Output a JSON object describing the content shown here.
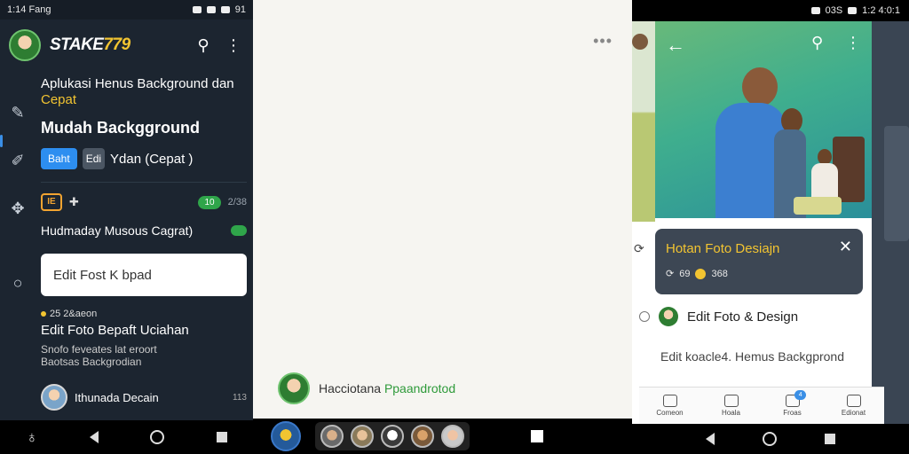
{
  "left": {
    "status_time": "1:14 Fang",
    "status_right": "91",
    "brand_text": "STAKE",
    "brand_num": "779",
    "heading_line": "Aplukasi Henus Background dan",
    "heading_highlight": "Cepat",
    "subtitle": "Mudah Backgground",
    "chip_blue": "Baht",
    "chip_gray": "Edi",
    "chip_text": "Ydan (Cepat )",
    "row_icon_label": "IE",
    "pill": "10",
    "pill_num": "2/38",
    "line_text": "Hudmaday Musous Cagrat)",
    "card_text": "Edit Fost K bpad",
    "meta_text": "25 2&aeon",
    "title3": "Edit Foto Bepaft Uciahan",
    "desc": "Snofo feveates lat eroort Baotsas Backgrodian",
    "last_text": "Ithunada Decain",
    "last_num": "113"
  },
  "middle": {
    "notif_prefix": "Hacciotana ",
    "notif_green": "Ppaandrotod"
  },
  "right": {
    "status_text": "03S",
    "status_time": "1:2 4:0:1",
    "popup_title": "Hotan Foto Desiajn",
    "popup_info_a": "69",
    "popup_info_b": "368",
    "row1_text": "Edit Foto & Design",
    "row2_text": "Edit koacle4.  Hemus Backgprond",
    "tabs": [
      {
        "label": "Comeon",
        "icon": "home-icon"
      },
      {
        "label": "Hoala",
        "icon": "info-icon"
      },
      {
        "label": "Froas",
        "icon": "chat-icon",
        "badge": "4"
      },
      {
        "label": "Edionat",
        "icon": "menu-icon"
      }
    ]
  }
}
